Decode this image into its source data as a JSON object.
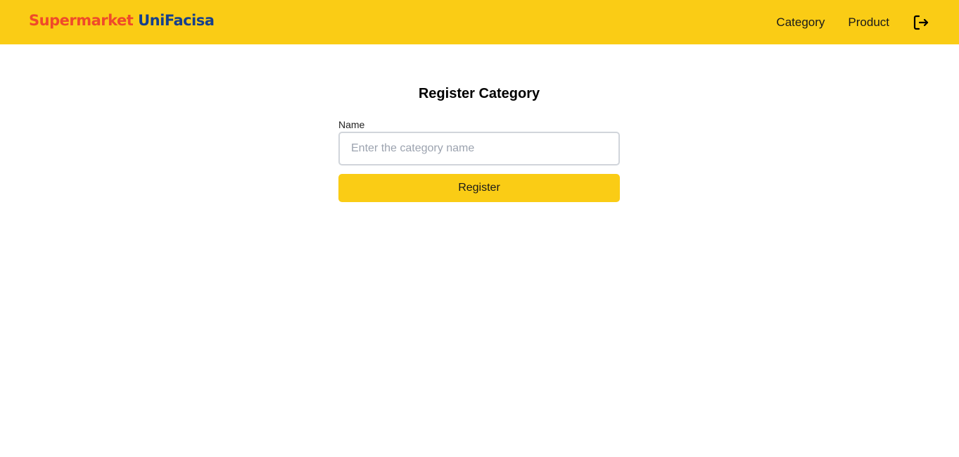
{
  "brand": {
    "part1": "Supermarket",
    "part2": "UniFacisa",
    "color1": "#ef4a2a",
    "color2": "#16408c"
  },
  "nav": {
    "items": [
      {
        "label": "Category"
      },
      {
        "label": "Product"
      }
    ],
    "logout_icon": "logout-icon"
  },
  "form": {
    "title": "Register Category",
    "name_label": "Name",
    "name_placeholder": "Enter the category name",
    "name_value": "",
    "submit_label": "Register"
  },
  "colors": {
    "accent": "#facc15"
  }
}
